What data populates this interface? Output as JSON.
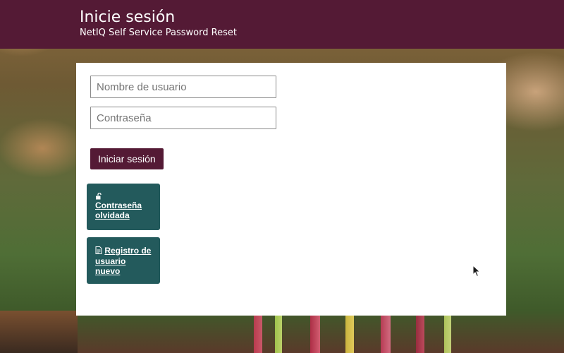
{
  "header": {
    "title": "Inicie sesión",
    "subtitle": "NetIQ Self Service Password Reset"
  },
  "form": {
    "username_placeholder": "Nombre de usuario",
    "username_value": "",
    "password_placeholder": "Contraseña",
    "password_value": "",
    "login_label": "Iniciar sesión"
  },
  "tiles": {
    "forgot": {
      "icon": "unlock-icon",
      "label": "Contraseña olvidada"
    },
    "register": {
      "icon": "document-icon",
      "label": "Registro de usuario nuevo"
    }
  },
  "colors": {
    "brand": "#541a35",
    "tile": "#235a5c"
  }
}
